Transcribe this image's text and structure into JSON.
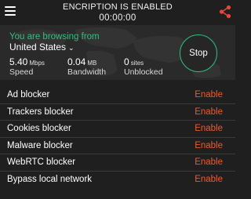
{
  "header": {
    "encryption_status": "ENCRIPTION IS ENABLED",
    "timer": "00:00:00",
    "menu_icon": "hamburger-menu-icon",
    "share_icon": "share-icon"
  },
  "connection": {
    "browsing_label": "You are browsing from",
    "country": "United States",
    "stop_label": "Stop",
    "stats": [
      {
        "value": "5.40",
        "unit": "Mbps",
        "label": "Speed"
      },
      {
        "value": "0.04",
        "unit": "MB",
        "label": "Bandwidth"
      },
      {
        "value": "0",
        "unit": "sites",
        "label": "Unblocked"
      }
    ]
  },
  "features": [
    {
      "name": "Ad blocker",
      "action": "Enable"
    },
    {
      "name": "Trackers blocker",
      "action": "Enable"
    },
    {
      "name": "Cookies blocker",
      "action": "Enable"
    },
    {
      "name": "Malware blocker",
      "action": "Enable"
    },
    {
      "name": "WebRTC blocker",
      "action": "Enable"
    },
    {
      "name": "Bypass local network",
      "action": "Enable"
    }
  ],
  "colors": {
    "accent_green": "#2ec27e",
    "action_orange": "#f05a2a",
    "share_red": "#e8453c",
    "background": "#1f1f1f"
  }
}
